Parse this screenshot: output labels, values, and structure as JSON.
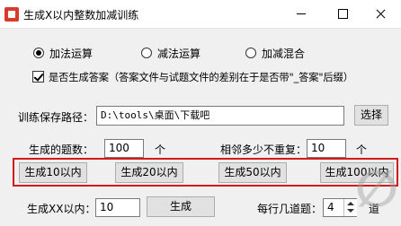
{
  "window": {
    "title": "生成X以内整数加减训练",
    "icon": "app-icon"
  },
  "operation": {
    "options": [
      {
        "label": "加法运算",
        "selected": true
      },
      {
        "label": "减法运算",
        "selected": false
      },
      {
        "label": "加减混合",
        "selected": false
      }
    ]
  },
  "answer_checkbox": {
    "label": "是否生成答案（答案文件与试题文件的差别在于是否带\"_答案\"后缀）",
    "checked": true
  },
  "save_path": {
    "label": "训练保存路径：",
    "value": "D:\\tools\\桌面\\下载吧",
    "browse_label": "选择"
  },
  "settings": {
    "count_label": "生成的题数：",
    "count_value": "100",
    "count_unit": "个",
    "norepeat_label": "相邻多少不重复：",
    "norepeat_value": "10",
    "norepeat_unit": "个"
  },
  "quick_buttons": [
    "生成10以内",
    "生成20以内",
    "生成50以内",
    "生成100以内"
  ],
  "custom": {
    "range_label": "生成XX以内：",
    "range_value": "10",
    "generate_label": "生成",
    "per_row_label": "每行几道题：",
    "per_row_value": "4",
    "per_row_unit": "道"
  },
  "highlight_color": "#d21a1a"
}
